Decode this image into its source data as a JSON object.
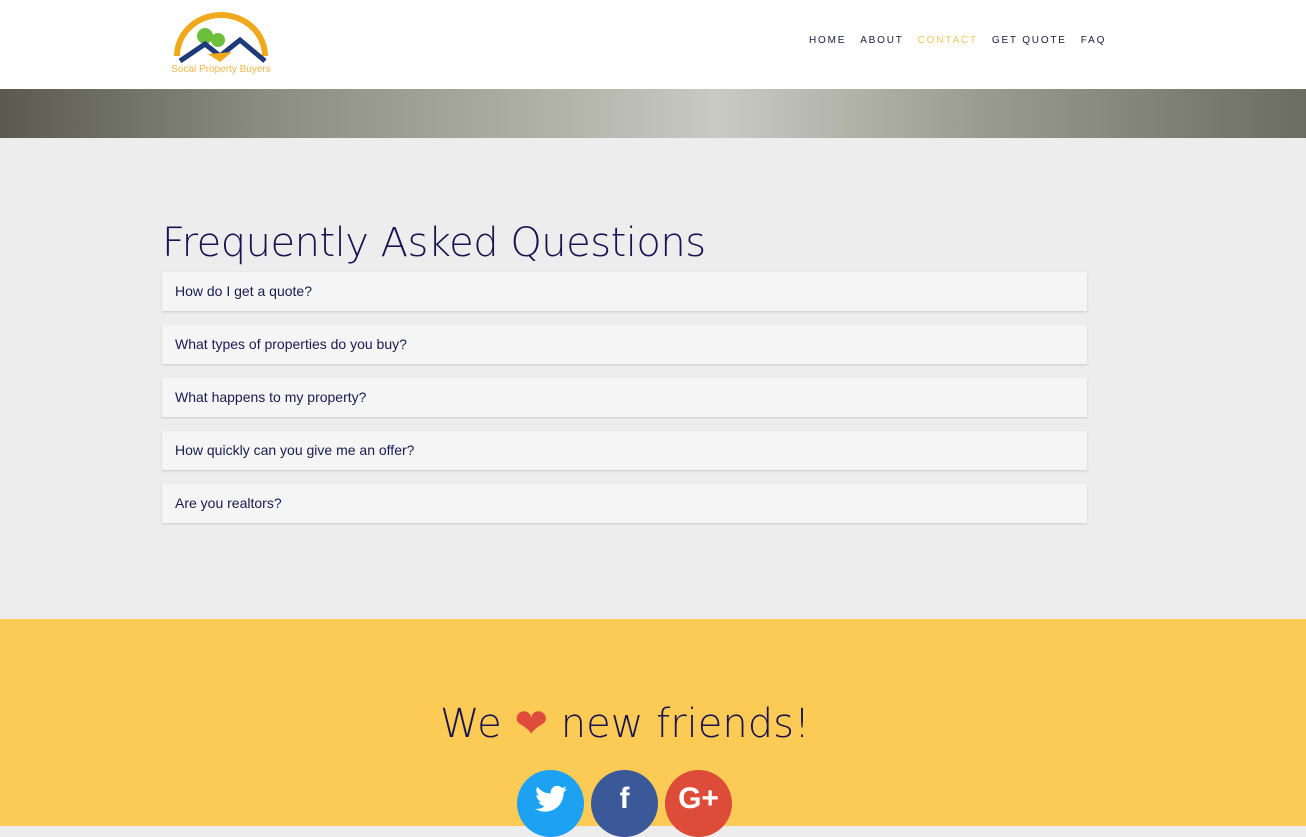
{
  "header": {
    "logo_text": "Socal Property Buyers",
    "nav": [
      {
        "label": "HOME"
      },
      {
        "label": "ABOUT"
      },
      {
        "label": "CONTACT",
        "active": true
      },
      {
        "label": "GET QUOTE"
      },
      {
        "label": "FAQ"
      }
    ]
  },
  "faq": {
    "title": "Frequently Asked Questions",
    "items": [
      "How do I get a quote?",
      "What types of properties do you buy?",
      "What happens to my property?",
      "How quickly can you give me an offer?",
      "Are you realtors?"
    ]
  },
  "footer": {
    "pre": "We",
    "heart": "❤",
    "post": "new friends!",
    "social": [
      {
        "icon": "twitter-icon",
        "glyph": "🐦",
        "color": "#1da1f2"
      },
      {
        "icon": "facebook-icon",
        "glyph": "f",
        "color": "#3b5998"
      },
      {
        "icon": "google-plus-icon",
        "glyph": "G+",
        "color": "#dd4b39"
      }
    ]
  },
  "colors": {
    "accent": "#fccb55",
    "title": "#1a1350",
    "active_nav": "#f1c75a"
  }
}
